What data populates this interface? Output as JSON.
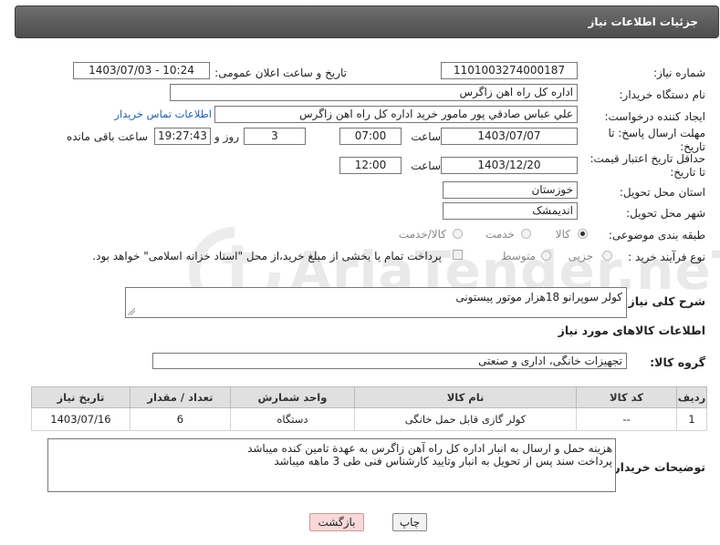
{
  "header": {
    "title": "جزئیات اطلاعات نیاز"
  },
  "watermark": "AriaTender.neT",
  "fields": {
    "need_number_label": "شماره نیاز:",
    "need_number": "1101003274000187",
    "announce_datetime_label": "تاریخ و ساعت اعلان عمومی:",
    "announce_datetime": "1403/07/03 - 10:24",
    "buyer_org_label": "نام دستگاه خریدار:",
    "buyer_org": "اداره کل راه اهن زاگرس",
    "requester_label": "ایجاد کننده درخواست:",
    "requester": "علي عباس صادقي پور مامور خرید اداره کل راه اهن زاگرس",
    "contact_link": "اطلاعات تماس خریدار",
    "reply_deadline_label": "مهلت ارسال پاسخ: تا تاریخ:",
    "reply_date": "1403/07/07",
    "time_label": "ساعت",
    "reply_time": "07:00",
    "days_value": "3",
    "days_label": "روز و",
    "remaining_time": "19:27:43",
    "remaining_label": "ساعت باقی مانده",
    "price_validity_label": "حداقل تاریخ اعتبار قیمت: تا تاریخ:",
    "price_date": "1403/12/20",
    "price_time": "12:00",
    "province_label": "استان محل تحویل:",
    "province": "خوزستان",
    "city_label": "شهر محل تحویل:",
    "city": "اندیمشک",
    "category_label": "طبقه بندی موضوعی:",
    "category_options": [
      "کالا",
      "خدمت",
      "کالا/خدمت"
    ],
    "process_label": "نوع فرآیند خرید :",
    "process_options": [
      "جزیی",
      "متوسط"
    ],
    "payment_note": "پرداخت تمام یا بخشی از مبلغ خرید،از محل \"اسناد خزانه اسلامی\" خواهد بود."
  },
  "description": {
    "label": "شرح کلی نیاز:",
    "value": "کولر سوپرانو 18هزار موتور پیستونی"
  },
  "goods_section_title": "اطلاعات کالاهای مورد نیاز",
  "goods_group": {
    "label": "گروه کالا:",
    "value": "تجهیزات خانگی، اداری و صنعتی"
  },
  "table": {
    "headers": [
      "ردیف",
      "کد کالا",
      "نام کالا",
      "واحد شمارش",
      "تعداد / مقدار",
      "تاریخ نیاز"
    ],
    "rows": [
      [
        "1",
        "--",
        "کولر گازی قابل حمل خانگی",
        "دستگاه",
        "6",
        "1403/07/16"
      ]
    ]
  },
  "buyer_notes": {
    "label": "توضیحات خریدار:",
    "line1": "هزینه حمل و ارسال به انبار اداره کل راه آهن زاگرس به عهدة تامین کنده میباشد",
    "line2": "پرداخت سند پس از تحویل به انبار وتایید کارشناس فنی طی 3 ماهه  میباشد"
  },
  "buttons": {
    "print": "چاپ",
    "back": "بازگشت"
  },
  "colors": {
    "header_bg": "#5a5a5a",
    "back_button_bg": "#f8d8d8",
    "link": "#1f5fb0"
  }
}
